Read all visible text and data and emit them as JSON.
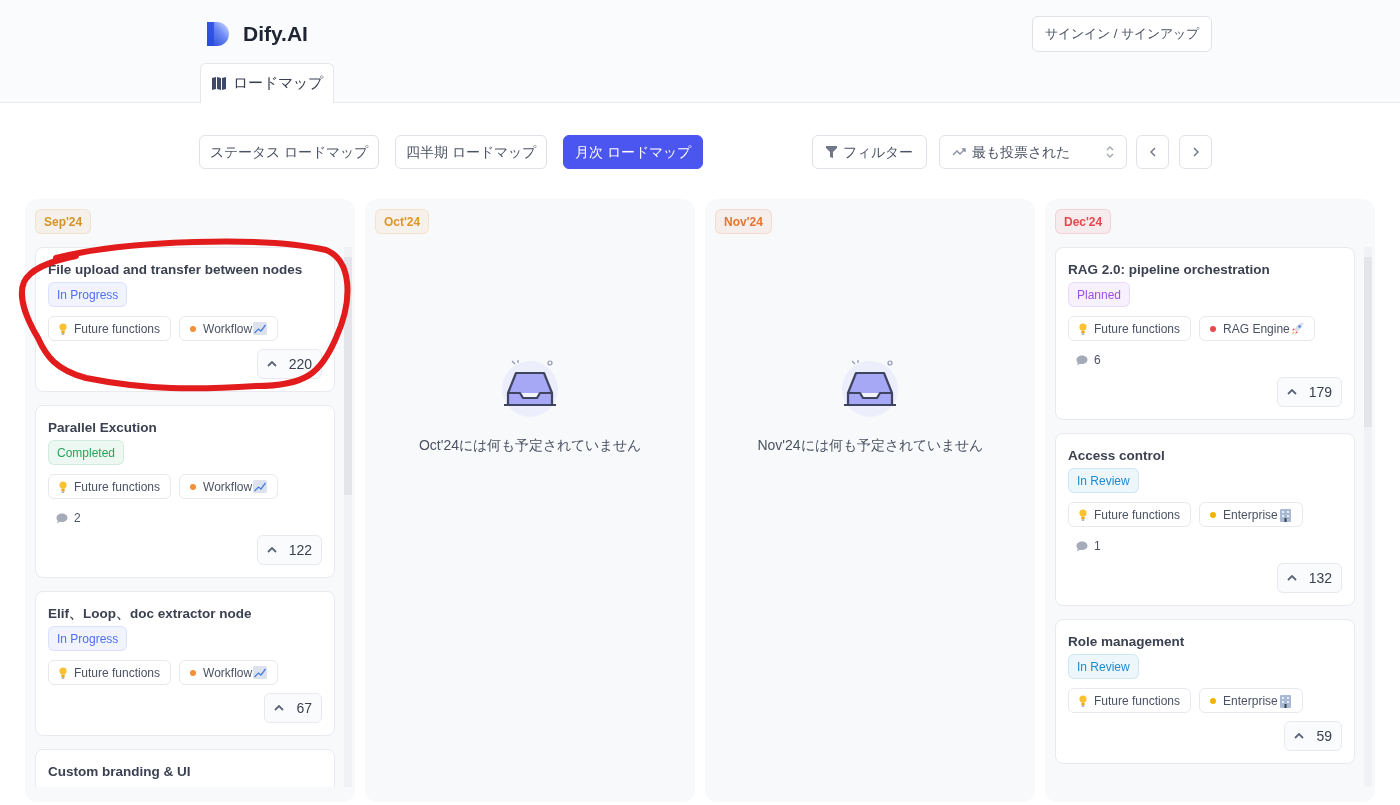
{
  "header": {
    "logo_text": "Dify.AI",
    "sign_in_button": "サインイン / サインアップ"
  },
  "nav_tabs": [
    {
      "label": "ロードマップ",
      "selected": true
    }
  ],
  "view_buttons": [
    {
      "label": "ステータス ロードマップ",
      "selected": false
    },
    {
      "label": "四半期 ロードマップ",
      "selected": false
    },
    {
      "label": "月次 ロードマップ",
      "selected": true
    }
  ],
  "filter_button": "フィルター",
  "sort_select": {
    "value": "最も投票された"
  },
  "columns": [
    {
      "month": "Sep'24",
      "color": "#d4932a",
      "cards": [
        {
          "title": "File upload and transfer between nodes",
          "status": {
            "label": "In Progress",
            "color": "#4f6ef7"
          },
          "tags": [
            {
              "kind": "idea",
              "label": "Future functions"
            },
            {
              "kind": "chart",
              "label": "Workflow",
              "color": "#f0913a"
            }
          ],
          "votes": "220"
        },
        {
          "title": "Parallel Excution",
          "status": {
            "label": "Completed",
            "color": "#22a55a"
          },
          "tags": [
            {
              "kind": "idea",
              "label": "Future functions"
            },
            {
              "kind": "chart",
              "label": "Workflow",
              "color": "#f0913a"
            }
          ],
          "comments": "2",
          "votes": "122"
        },
        {
          "title": "Elif、Loop、doc extractor node",
          "status": {
            "label": "In Progress",
            "color": "#4f6ef7"
          },
          "tags": [
            {
              "kind": "idea",
              "label": "Future functions"
            },
            {
              "kind": "chart",
              "label": "Workflow",
              "color": "#f0913a"
            }
          ],
          "votes": "67"
        },
        {
          "title": "Custom branding & UI"
        }
      ]
    },
    {
      "month": "Oct'24",
      "color": "#e0952a",
      "empty_message": "Oct'24には何も予定されていません"
    },
    {
      "month": "Nov'24",
      "color": "#e8742f",
      "empty_message": "Nov'24には何も予定されていません"
    },
    {
      "month": "Dec'24",
      "color": "#e5484d",
      "cards": [
        {
          "title": "RAG 2.0: pipeline orchestration",
          "status": {
            "label": "Planned",
            "color": "#9d4fe8"
          },
          "tags": [
            {
              "kind": "idea",
              "label": "Future functions"
            },
            {
              "kind": "rocket",
              "label": "RAG Engine",
              "color": "#e5484d"
            }
          ],
          "comments": "6",
          "votes": "179"
        },
        {
          "title": "Access control",
          "status": {
            "label": "In Review",
            "color": "#1d8bd1"
          },
          "tags": [
            {
              "kind": "idea",
              "label": "Future functions"
            },
            {
              "kind": "building",
              "label": "Enterprise",
              "color": "#f5b400"
            }
          ],
          "comments": "1",
          "votes": "132"
        },
        {
          "title": "Role management",
          "status": {
            "label": "In Review",
            "color": "#1d8bd1"
          },
          "tags": [
            {
              "kind": "idea",
              "label": "Future functions"
            },
            {
              "kind": "building",
              "label": "Enterprise",
              "color": "#f5b400"
            }
          ],
          "votes": "59"
        }
      ]
    }
  ]
}
